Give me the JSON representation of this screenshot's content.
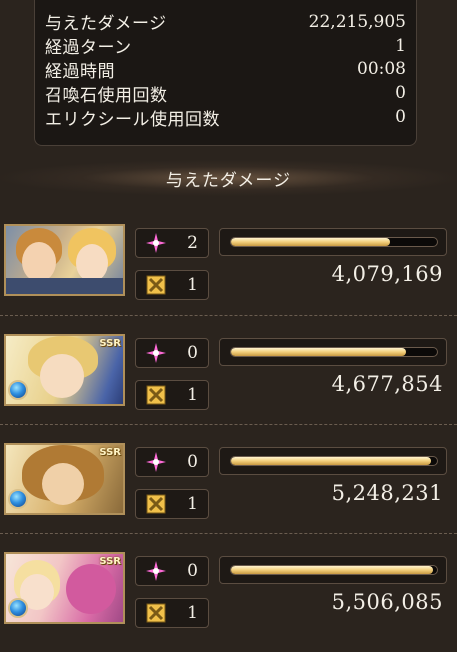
{
  "summary": {
    "damage_label": "与えたダメージ",
    "damage_value": "22,215,905",
    "turns_label": "経過ターン",
    "turns_value": "1",
    "time_label": "経過時間",
    "time_value": "00:08",
    "summon_label": "召喚石使用回数",
    "summon_value": "0",
    "elixir_label": "エリクシール使用回数",
    "elixir_value": "0"
  },
  "section_title": "与えたダメージ",
  "characters": [
    {
      "portrait": "main-character-portrait",
      "star_count": "2",
      "ability_count": "1",
      "gauge_fraction": 0.77,
      "damage": "4,079,169"
    },
    {
      "portrait": "ssr-light-character-portrait",
      "star_count": "0",
      "ability_count": "1",
      "gauge_fraction": 0.85,
      "damage": "4,677,854",
      "rarity": "SSR"
    },
    {
      "portrait": "ssr-lion-character-portrait",
      "star_count": "0",
      "ability_count": "1",
      "gauge_fraction": 0.97,
      "damage": "5,248,231",
      "rarity": "SSR"
    },
    {
      "portrait": "ssr-dragon-character-portrait",
      "star_count": "0",
      "ability_count": "1",
      "gauge_fraction": 0.98,
      "damage": "5,506,085",
      "rarity": "SSR"
    }
  ],
  "colors": {
    "gauge_fill": "#f2cf7c",
    "star_icon": "#ff6bd8",
    "ability_icon": "#f0c04a",
    "element_water": "#2f8fe0"
  }
}
